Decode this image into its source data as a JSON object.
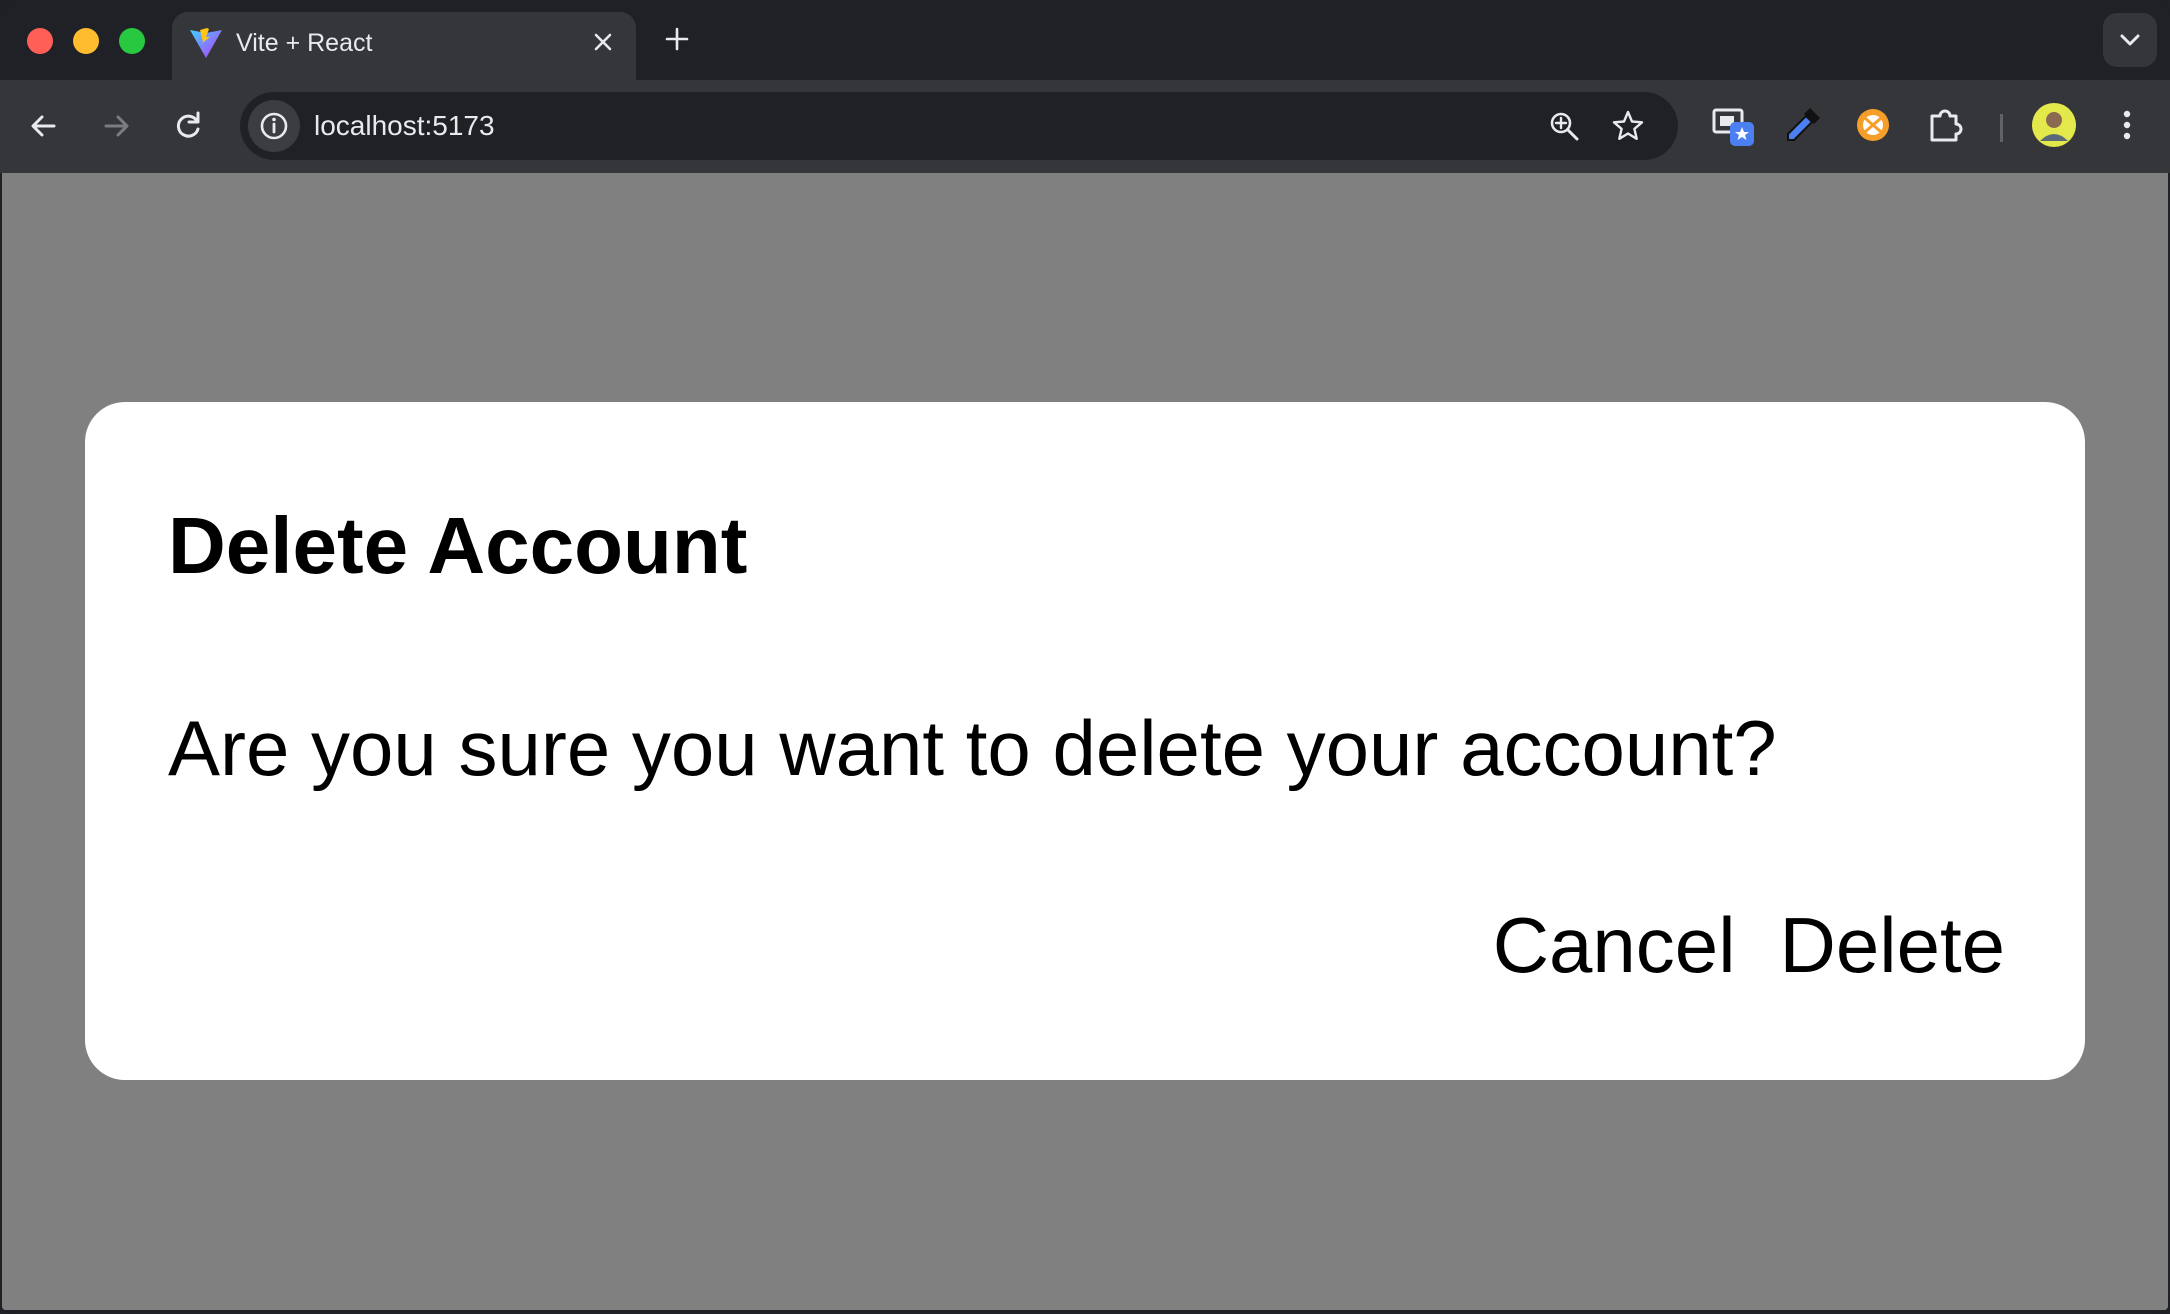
{
  "browser": {
    "tab": {
      "title": "Vite + React",
      "favicon": "vite-logo-icon"
    },
    "address_bar": {
      "url": "localhost:5173"
    },
    "icons": {
      "close_tab": "close-icon",
      "new_tab": "plus-icon",
      "tab_search": "chevron-down-icon",
      "back": "arrow-left-icon",
      "forward": "arrow-right-icon",
      "reload": "reload-icon",
      "site_info": "info-icon",
      "zoom": "zoom-in-icon",
      "bookmark": "star-icon",
      "extensions": [
        "screen-capture-extension-icon",
        "eyedropper-extension-icon",
        "orange-extension-icon",
        "puzzle-piece-icon"
      ],
      "profile": "avatar-icon",
      "menu": "kebab-menu-icon"
    },
    "colors": {
      "window": "#1f2127",
      "toolbar": "#35363a",
      "omnibox": "#202124",
      "text": "#e8eaed"
    }
  },
  "page": {
    "backdrop_color": "#808080",
    "dialog": {
      "title": "Delete Account",
      "message": "Are you sure you want to delete your account?",
      "cancel_label": "Cancel",
      "delete_label": "Delete",
      "background": "#ffffff"
    }
  }
}
